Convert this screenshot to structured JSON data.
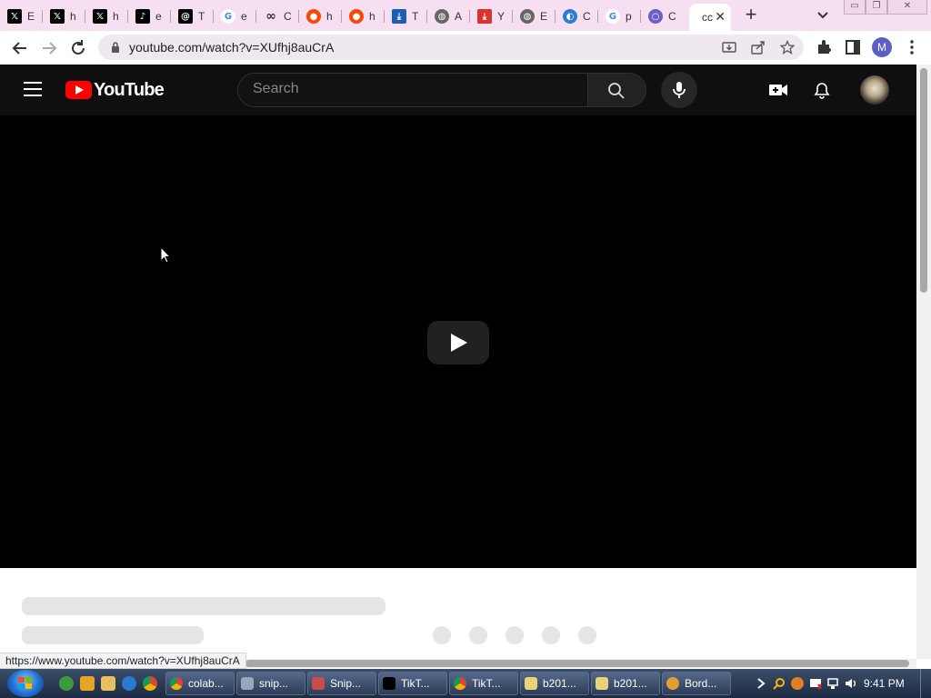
{
  "browser": {
    "tabs": [
      {
        "title": "E",
        "icon": "x-logo-icon",
        "color": "#000000"
      },
      {
        "title": "h",
        "icon": "x-logo-icon",
        "color": "#000000"
      },
      {
        "title": "h",
        "icon": "x-logo-icon",
        "color": "#000000"
      },
      {
        "title": "e",
        "icon": "tiktok-icon",
        "color": "#000000"
      },
      {
        "title": "T",
        "icon": "threads-icon",
        "color": "#000000"
      },
      {
        "title": "e",
        "icon": "google-icon",
        "color": "#4285f4"
      },
      {
        "title": "C",
        "icon": "infinity-icon",
        "color": "#333333"
      },
      {
        "title": "h",
        "icon": "reddit-icon",
        "color": "#ff4500"
      },
      {
        "title": "h",
        "icon": "reddit-icon",
        "color": "#ff4500"
      },
      {
        "title": "T",
        "icon": "download-icon",
        "color": "#1a5fb4"
      },
      {
        "title": "A",
        "icon": "globe-icon",
        "color": "#666666"
      },
      {
        "title": "Y",
        "icon": "download-red-icon",
        "color": "#d9342b"
      },
      {
        "title": "E",
        "icon": "globe-icon",
        "color": "#666666"
      },
      {
        "title": "C",
        "icon": "copilot-icon",
        "color": "#2b7bd9"
      },
      {
        "title": "p",
        "icon": "google-icon",
        "color": "#4285f4"
      },
      {
        "title": "C",
        "icon": "circle-icon",
        "color": "#6b5fc7"
      },
      {
        "title": "cc",
        "icon": "none",
        "color": "#ffffff",
        "active": true
      }
    ],
    "url": "youtube.com/watch?v=XUfhj8auCrA",
    "profile_initial": "M",
    "status_url": "https://www.youtube.com/watch?v=XUfhj8auCrA"
  },
  "youtube": {
    "logo_text": "YouTube",
    "search_placeholder": "Search"
  },
  "taskbar": {
    "buttons": [
      {
        "label": "colab...",
        "icon": "chrome-icon"
      },
      {
        "label": "snip...",
        "icon": "snipping-icon"
      },
      {
        "label": "Snip...",
        "icon": "snipping-tool-icon"
      },
      {
        "label": "TikT...",
        "icon": "tiktok-icon"
      },
      {
        "label": "TikT...",
        "icon": "chrome-icon"
      },
      {
        "label": "b201...",
        "icon": "folder-zip-icon"
      },
      {
        "label": "b201...",
        "icon": "folder-zip-icon"
      },
      {
        "label": "Bord...",
        "icon": "app-icon"
      }
    ],
    "clock": "9:41 PM"
  }
}
